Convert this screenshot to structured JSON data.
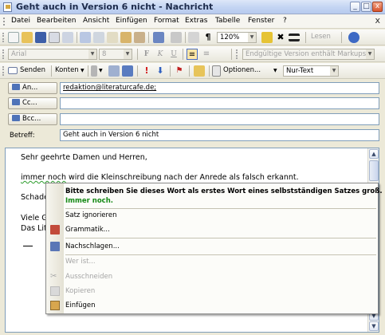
{
  "window": {
    "title": "Geht auch in Version 6 nicht - Nachricht",
    "buttons": [
      "_",
      "□",
      "x"
    ]
  },
  "menu": {
    "items": [
      "Datei",
      "Bearbeiten",
      "Ansicht",
      "Einfügen",
      "Format",
      "Extras",
      "Tabelle",
      "Fenster",
      "?"
    ],
    "close": "x"
  },
  "toolbar_standard": {
    "zoom": "120%",
    "read_label": "Lesen"
  },
  "toolbar_format": {
    "font": "Arial",
    "size": "8",
    "bold": "F",
    "italic": "K",
    "underline": "U",
    "markup_status": "Endgültige Version enthält Markups"
  },
  "toolbar_mail": {
    "send": "Senden",
    "accounts": "Konten",
    "options": "Optionen...",
    "format": "Nur-Text"
  },
  "fields": {
    "to_label": "An...",
    "to_value": "redaktion@literaturcafe.de;",
    "cc_label": "Cc...",
    "cc_value": "",
    "bcc_label": "Bcc...",
    "bcc_value": "",
    "subject_label": "Betreff:",
    "subject_value": "Geht auch in Version 6 nicht"
  },
  "body": {
    "line1": "Sehr geehrte Damen und Herren,",
    "line2_word": "immer noch",
    "line2_rest": " wird die Kleinschreibung nach der Anrede als falsch erkannt.",
    "line3": "Schade",
    "line4": "Viele G",
    "line5": "Das Lit"
  },
  "context_menu": {
    "suggestion_text": "Bitte schreiben Sie dieses Wort als erstes Wort eines selbstständigen Satzes groß.",
    "suggestion_fix": "Immer noch.",
    "ignore": "Satz ignorieren",
    "grammar": "Grammatik...",
    "lookup": "Nachschlagen...",
    "who": "Wer ist...",
    "cut": "Ausschneiden",
    "copy": "Kopieren",
    "paste": "Einfügen"
  }
}
